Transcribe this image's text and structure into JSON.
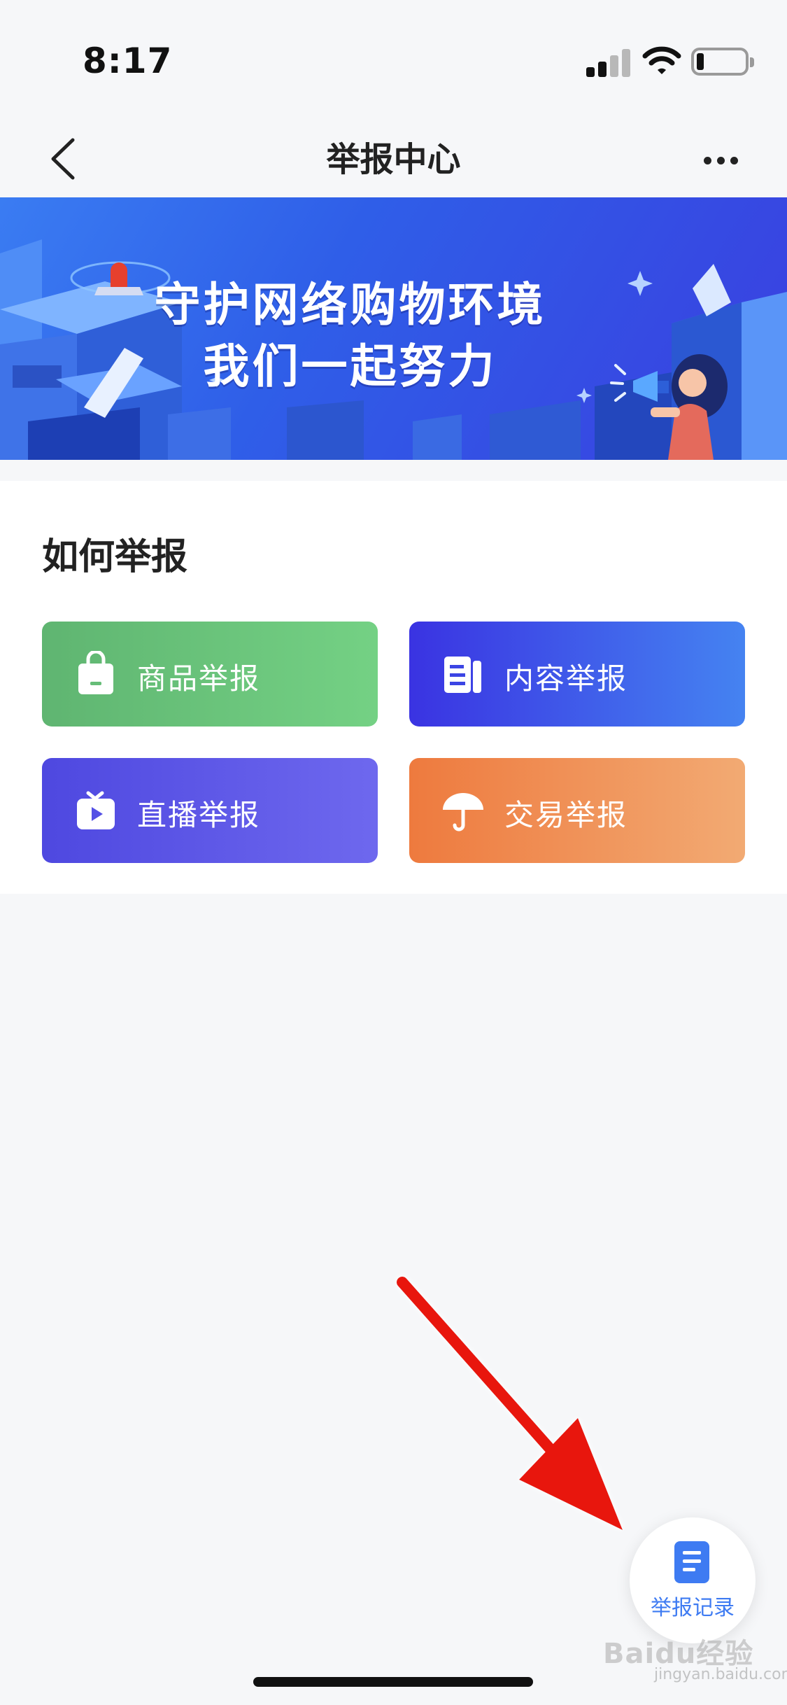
{
  "status_bar": {
    "time": "8:17"
  },
  "nav": {
    "title": "举报中心"
  },
  "banner": {
    "line1": "守护网络购物环境",
    "line2": "我们一起努力"
  },
  "section": {
    "title": "如何举报",
    "buttons": [
      {
        "label": "商品举报",
        "icon": "shopping-bag-icon",
        "color_from": "#5fb571",
        "color_to": "#74d184"
      },
      {
        "label": "内容举报",
        "icon": "document-icon",
        "color_from": "#3a33e2",
        "color_to": "#4583f1"
      },
      {
        "label": "直播举报",
        "icon": "tv-play-icon",
        "color_from": "#4e48e0",
        "color_to": "#6e68ee"
      },
      {
        "label": "交易举报",
        "icon": "umbrella-icon",
        "color_from": "#ee7a3e",
        "color_to": "#f2aa73"
      }
    ]
  },
  "fab": {
    "label": "举报记录",
    "icon": "list-document-icon",
    "color": "#3e7bf2"
  },
  "watermark": {
    "text": "Baidu经验",
    "sub": "jingyan.baidu.com"
  },
  "annotation": {
    "arrow_color": "#e8130f"
  }
}
